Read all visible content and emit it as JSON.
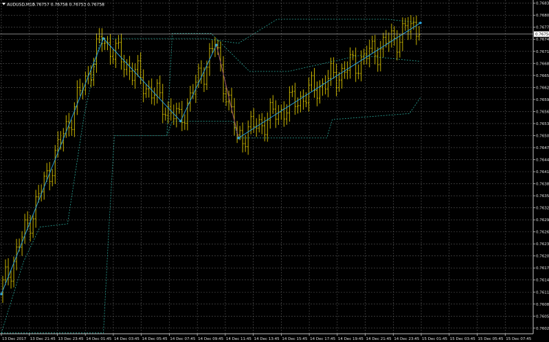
{
  "window": {
    "symbol_label": "AUDUSD,M15",
    "ohlc_label": "0.76757 0.76758 0.76753 0.76758",
    "menu_icon": "dropdown-arrow-icon"
  },
  "chart_data": {
    "type": "candlestick",
    "grid": true,
    "ylim": [
      0.76011,
      0.76843
    ],
    "y_ticks": [
      "0.76835",
      "0.76805",
      "0.76775",
      "0.76745",
      "0.76715",
      "0.76685",
      "0.76655",
      "0.76625",
      "0.76595",
      "0.76565",
      "0.76535",
      "0.76505",
      "0.76475",
      "0.76445",
      "0.76415",
      "0.76385",
      "0.76355",
      "0.76325",
      "0.76295",
      "0.76265",
      "0.76235",
      "0.76205",
      "0.76175",
      "0.76145",
      "0.76115",
      "0.76085",
      "0.76055",
      "0.76025"
    ],
    "x_ticks": [
      "13 Dec 2017",
      "13 Dec 21:45",
      "13 Dec 23:45",
      "14 Dec 01:45",
      "14 Dec 03:45",
      "14 Dec 05:45",
      "14 Dec 07:45",
      "14 Dec 09:45",
      "14 Dec 11:45",
      "14 Dec 13:45",
      "14 Dec 15:45",
      "14 Dec 17:45",
      "14 Dec 19:45",
      "14 Dec 21:45",
      "14 Dec 23:45",
      "15 Dec 01:45",
      "15 Dec 03:45",
      "15 Dec 05:45",
      "15 Dec 07:45"
    ],
    "current_price": "0.76758",
    "bar_count": 152,
    "zigzag": [
      {
        "bar": 0,
        "price": 0.7611
      },
      {
        "bar": 37,
        "price": 0.76747
      },
      {
        "bar": 65,
        "price": 0.76541
      },
      {
        "bar": 78,
        "price": 0.76731
      },
      {
        "bar": 86,
        "price": 0.76499
      },
      {
        "bar": 152,
        "price": 0.76786
      }
    ],
    "channel_upper": [
      {
        "bar": 0,
        "price": 0.76013
      },
      {
        "bar": 8,
        "price": 0.7619
      },
      {
        "bar": 14,
        "price": 0.76277
      },
      {
        "bar": 24,
        "price": 0.76285
      },
      {
        "bar": 30,
        "price": 0.76555
      },
      {
        "bar": 36,
        "price": 0.76747
      },
      {
        "bar": 66,
        "price": 0.76747
      },
      {
        "bar": 74,
        "price": 0.76747
      },
      {
        "bar": 86,
        "price": 0.76735
      },
      {
        "bar": 100,
        "price": 0.76795
      },
      {
        "bar": 120,
        "price": 0.76795
      },
      {
        "bar": 140,
        "price": 0.76795
      },
      {
        "bar": 152,
        "price": 0.76786
      }
    ],
    "channel_lower": [
      {
        "bar": 0,
        "price": 0.76013
      },
      {
        "bar": 37,
        "price": 0.76013
      },
      {
        "bar": 39,
        "price": 0.76275
      },
      {
        "bar": 41,
        "price": 0.76505
      },
      {
        "bar": 60,
        "price": 0.76505
      },
      {
        "bar": 62,
        "price": 0.76541
      },
      {
        "bar": 84,
        "price": 0.76541
      },
      {
        "bar": 86,
        "price": 0.76499
      },
      {
        "bar": 118,
        "price": 0.76499
      },
      {
        "bar": 120,
        "price": 0.76545
      },
      {
        "bar": 148,
        "price": 0.7656
      },
      {
        "bar": 152,
        "price": 0.766
      }
    ],
    "channel_inner": [
      {
        "bar": 60,
        "price": 0.76505
      },
      {
        "bar": 62,
        "price": 0.7676
      },
      {
        "bar": 76,
        "price": 0.7676
      },
      {
        "bar": 90,
        "price": 0.76665
      },
      {
        "bar": 104,
        "price": 0.76665
      },
      {
        "bar": 130,
        "price": 0.76705
      },
      {
        "bar": 152,
        "price": 0.7669
      }
    ],
    "colors": {
      "background": "#000000",
      "grid": "#5a5a5a",
      "candles": "#c8b400",
      "zigzag": "#2a9fd8",
      "channel": "#2aa89a",
      "zigzag_down_segment": "#c04040",
      "price_line": "#c8c8c8",
      "price_label_bg": "#ffffff",
      "axis_text": "#e0e0e0",
      "title_text": "#ffffff"
    }
  }
}
